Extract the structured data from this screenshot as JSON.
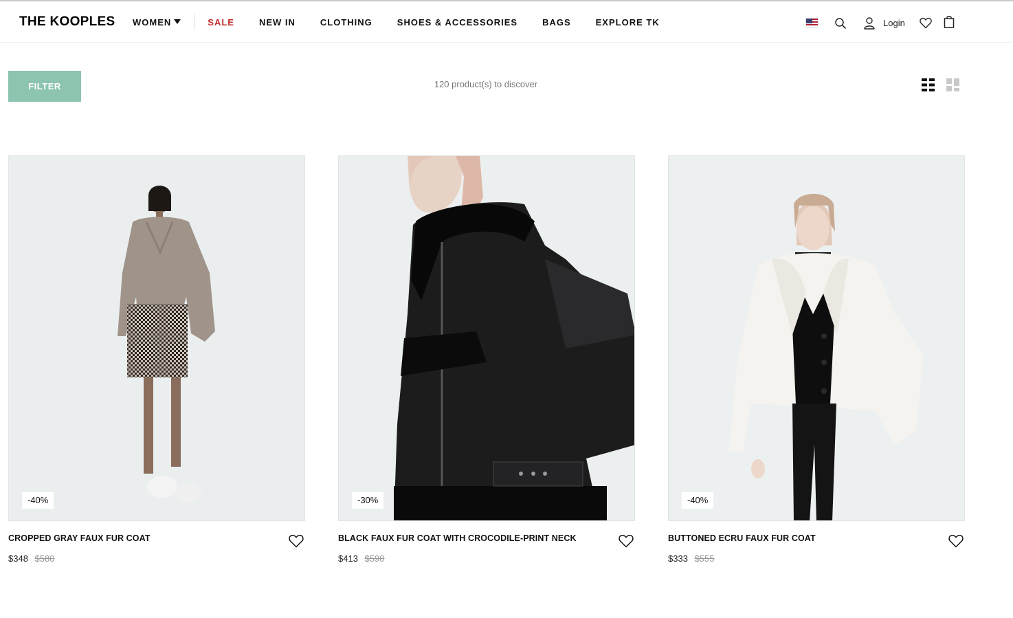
{
  "header": {
    "logo": "THE KOOPLES",
    "nav": {
      "women": "WOMEN",
      "sale": "SALE",
      "new_in": "NEW IN",
      "clothing": "CLOTHING",
      "shoes_accessories": "SHOES & ACCESSORIES",
      "bags": "BAGS",
      "explore": "EXPLORE TK"
    },
    "login": "Login",
    "sale_color": "#c42a2a"
  },
  "toolbar": {
    "filter_label": "FILTER",
    "filter_color": "#8cc4b0",
    "count_text": "120 product(s) to discover"
  },
  "products": [
    {
      "name": "CROPPED GRAY FAUX FUR COAT",
      "price": "$348",
      "old_price": "$580",
      "badge": "-40%"
    },
    {
      "name": "BLACK FAUX FUR COAT WITH CROCODILE-PRINT NECK",
      "price": "$413",
      "old_price": "$590",
      "badge": "-30%"
    },
    {
      "name": "BUTTONED ECRU FAUX FUR COAT",
      "price": "$333",
      "old_price": "$555",
      "badge": "-40%"
    }
  ]
}
